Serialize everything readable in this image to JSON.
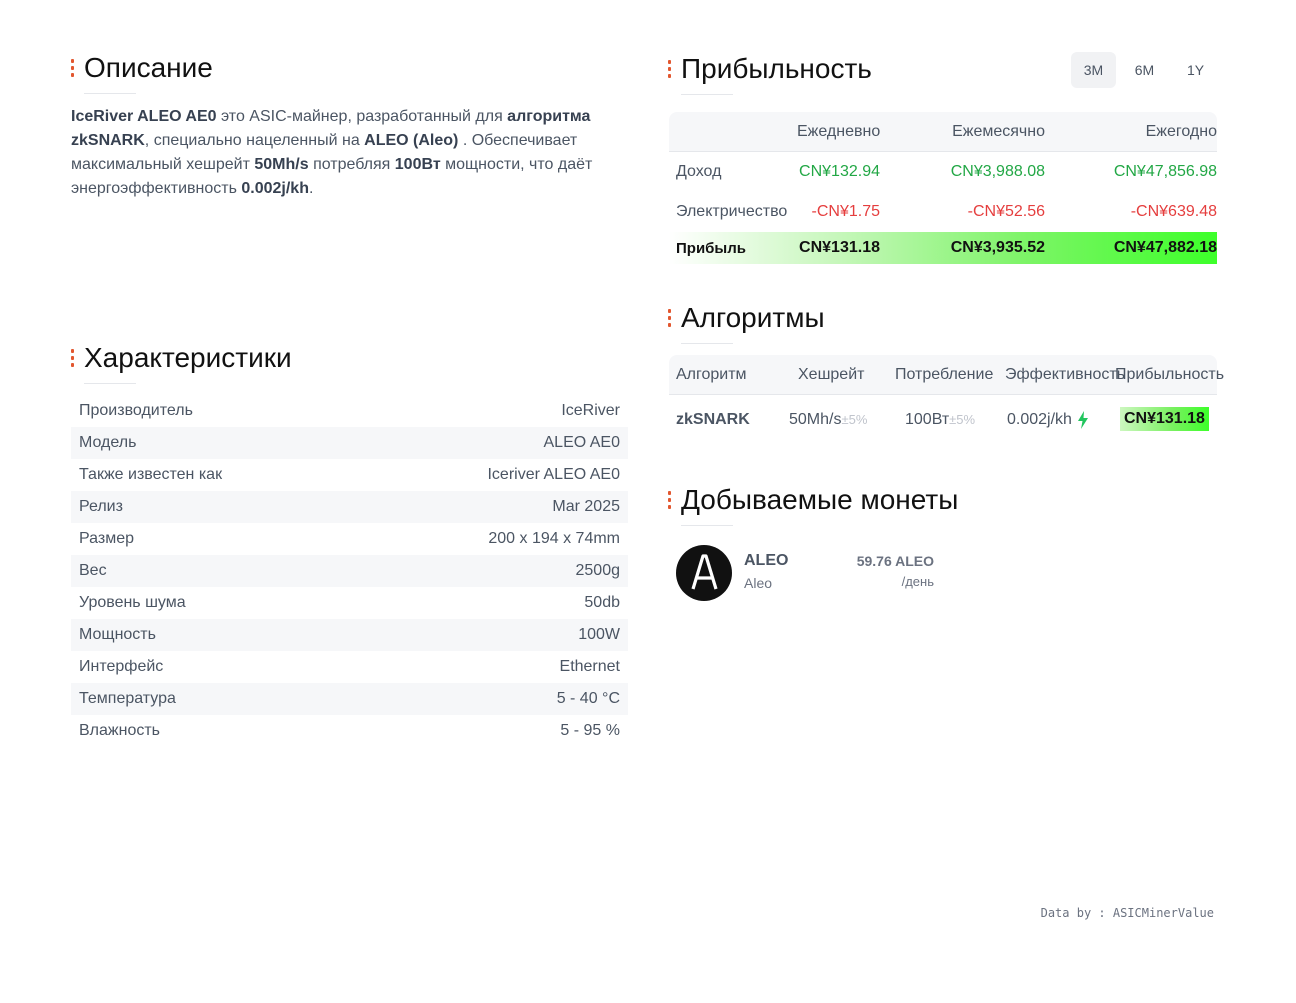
{
  "description": {
    "title": "Описание",
    "parts": [
      {
        "text": "IceRiver ALEO AE0",
        "bold": true
      },
      {
        "text": " это ASIC-майнер, разработанный для ",
        "bold": false
      },
      {
        "text": "алгоритма zkSNARK",
        "bold": true
      },
      {
        "text": ", специально нацеленный на ",
        "bold": false
      },
      {
        "text": "ALEO (Aleo)",
        "bold": true
      },
      {
        "text": " . Обеспечивает максимальный хешрейт ",
        "bold": false
      },
      {
        "text": "50Mh/s",
        "bold": true
      },
      {
        "text": " потребляя ",
        "bold": false
      },
      {
        "text": "100Вт",
        "bold": true
      },
      {
        "text": " мощности, что даёт энергоэффективность ",
        "bold": false
      },
      {
        "text": "0.002j/kh",
        "bold": true
      },
      {
        "text": ".",
        "bold": false
      }
    ]
  },
  "specs": {
    "title": "Характеристики",
    "rows": [
      {
        "label": "Производитель",
        "value": "IceRiver"
      },
      {
        "label": "Модель",
        "value": "ALEO AE0"
      },
      {
        "label": "Также известен как",
        "value": "Iceriver ALEO AE0"
      },
      {
        "label": "Релиз",
        "value": "Mar 2025"
      },
      {
        "label": "Размер",
        "value": "200 x 194 x 74mm"
      },
      {
        "label": "Вес",
        "value": "2500g"
      },
      {
        "label": "Уровень шума",
        "value": "50db"
      },
      {
        "label": "Мощность",
        "value": "100W"
      },
      {
        "label": "Интерфейс",
        "value": "Ethernet"
      },
      {
        "label": "Температура",
        "value": "5 - 40 °C"
      },
      {
        "label": "Влажность",
        "value": "5 - 95 %"
      }
    ]
  },
  "profitability": {
    "title": "Прибыльность",
    "periods": [
      "3M",
      "6M",
      "1Y"
    ],
    "active_period": "3M",
    "columns": [
      "Ежедневно",
      "Ежемесячно",
      "Ежегодно"
    ],
    "income": {
      "label": "Доход",
      "values": [
        "CN¥132.94",
        "CN¥3,988.08",
        "CN¥47,856.98"
      ]
    },
    "electricity": {
      "label": "Электричество",
      "values": [
        "-CN¥1.75",
        "-CN¥52.56",
        "-CN¥639.48"
      ]
    },
    "profit": {
      "label": "Прибыль",
      "values": [
        "CN¥131.18",
        "CN¥3,935.52",
        "CN¥47,882.18"
      ]
    },
    "colors": {
      "positive": "#22a745",
      "negative": "#e53e3e",
      "highlight": "#3dff2a"
    }
  },
  "algorithms": {
    "title": "Алгоритмы",
    "headers": [
      "Алгоритм",
      "Хешрейт",
      "Потребление",
      "Эффективность",
      "Прибыльность"
    ],
    "rows": [
      {
        "name": "zkSNARK",
        "hashrate": "50Mh/s",
        "hashrate_tol": "±5%",
        "power": "100Вт",
        "power_tol": "±5%",
        "efficiency": "0.002j/kh",
        "efficiency_icon": "lightning-icon",
        "profit": "CN¥131.18"
      }
    ]
  },
  "coins": {
    "title": "Добываемые монеты",
    "items": [
      {
        "symbol": "ALEO",
        "name": "Aleo",
        "amount": "59.76 ALEO",
        "per": "/день",
        "logo_icon": "aleo-logo-icon"
      }
    ]
  },
  "footer": {
    "credit": "Data by : ASICMinerValue"
  }
}
